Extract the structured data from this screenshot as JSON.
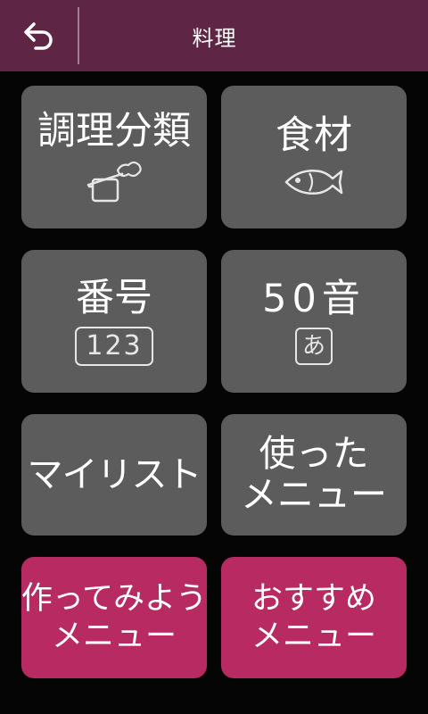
{
  "header": {
    "title": "料理",
    "back_icon": "back-arrow-icon",
    "background": "#5e2545"
  },
  "tiles": {
    "cooking_category": {
      "label": "調理分類",
      "icon": "pot-icon"
    },
    "ingredients": {
      "label": "食材",
      "icon": "fish-icon"
    },
    "number": {
      "label": "番号",
      "badge": "123"
    },
    "syllabary": {
      "label": "50音",
      "badge": "あ"
    },
    "my_list": {
      "label": "マイリスト"
    },
    "used_menu": {
      "line1": "使った",
      "line2": "メニュー"
    },
    "try_menu": {
      "line1": "作ってみよう",
      "line2": "メニュー"
    },
    "recommended_menu": {
      "line1": "おすすめ",
      "line2": "メニュー"
    }
  },
  "colors": {
    "tile": "#5c5c5c",
    "accent_tile": "#b82a62",
    "background": "#050505"
  }
}
